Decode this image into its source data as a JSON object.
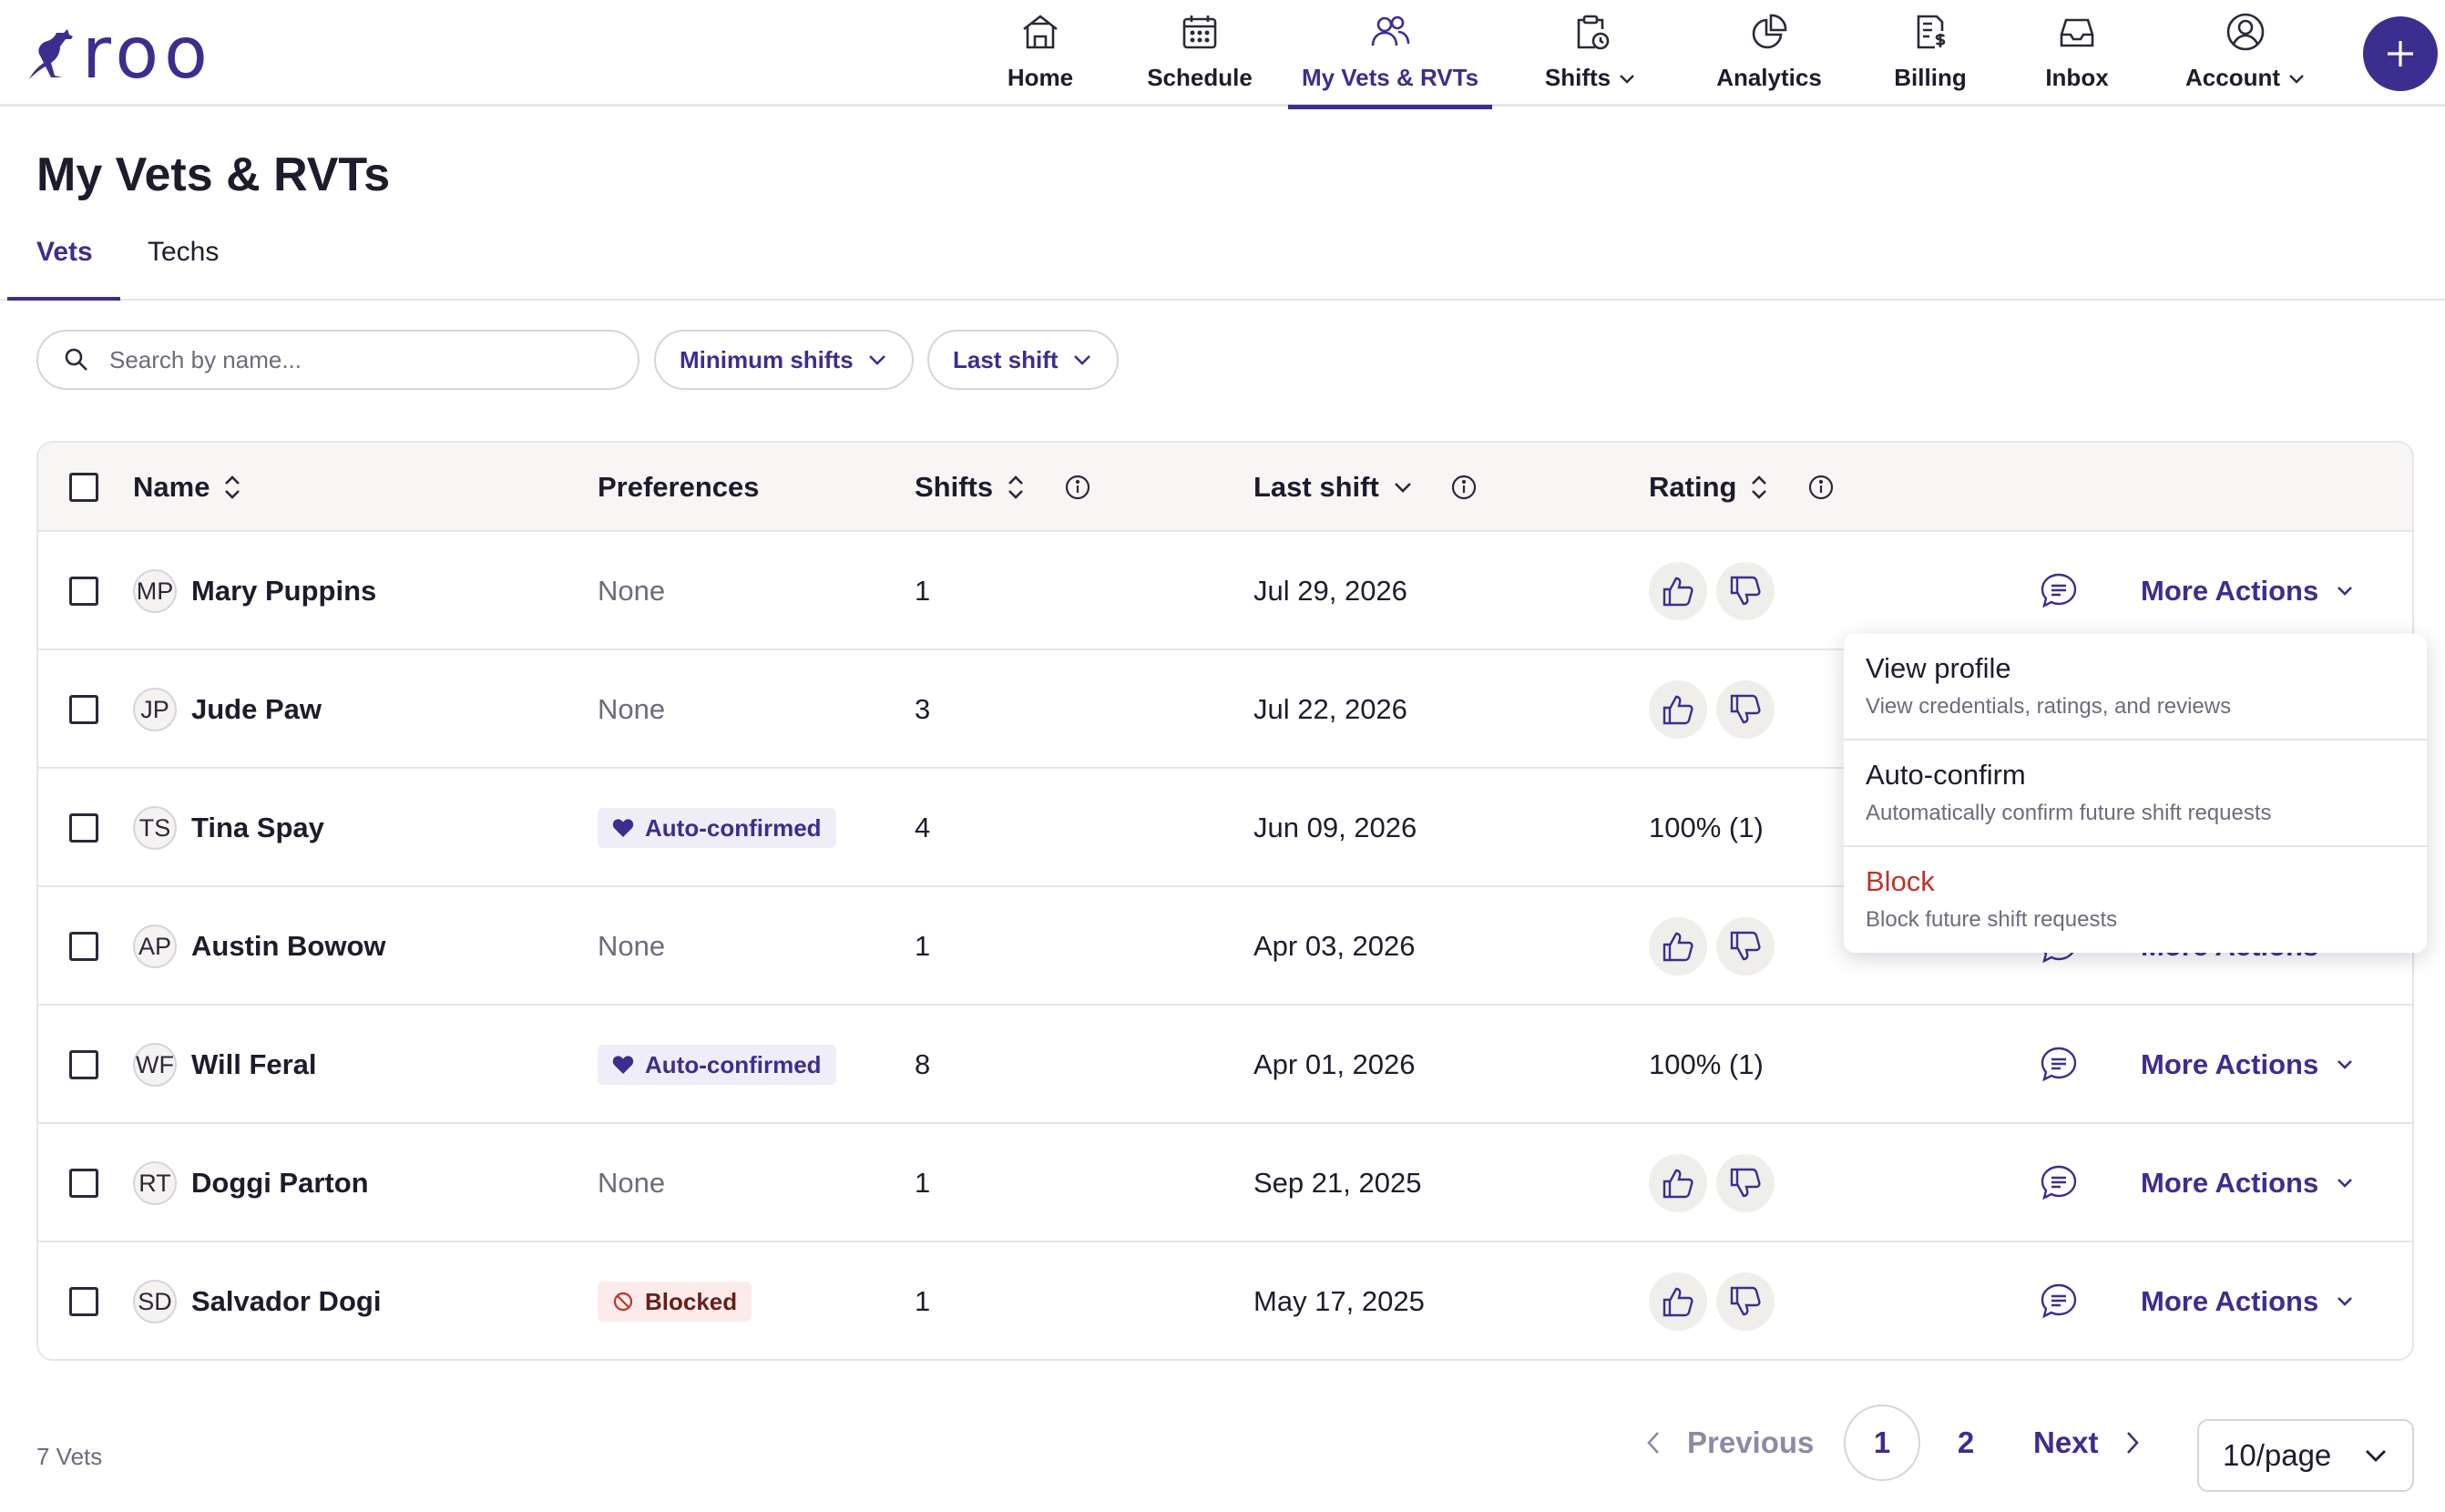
{
  "brand": {
    "name": "roo",
    "color": "#3c2e8f"
  },
  "nav": [
    {
      "label": "Home",
      "icon": "home-icon"
    },
    {
      "label": "Schedule",
      "icon": "calendar-icon"
    },
    {
      "label": "My Vets & RVTs",
      "icon": "people-icon",
      "active": true
    },
    {
      "label": "Shifts",
      "icon": "clipboard-clock-icon",
      "dropdown": true
    },
    {
      "label": "Analytics",
      "icon": "pie-chart-icon"
    },
    {
      "label": "Billing",
      "icon": "invoice-icon"
    },
    {
      "label": "Inbox",
      "icon": "inbox-icon"
    },
    {
      "label": "Account",
      "icon": "account-icon",
      "dropdown": true
    }
  ],
  "page": {
    "title": "My Vets & RVTs"
  },
  "tabs": [
    {
      "label": "Vets",
      "active": true
    },
    {
      "label": "Techs"
    }
  ],
  "filters": {
    "search_placeholder": "Search by name...",
    "min_shifts": "Minimum shifts",
    "last_shift": "Last shift"
  },
  "table": {
    "headers": {
      "name": "Name",
      "preferences": "Preferences",
      "shifts": "Shifts",
      "last_shift": "Last shift",
      "rating": "Rating"
    },
    "rows": [
      {
        "initials": "MP",
        "name": "Mary Puppins",
        "preference": "None",
        "shifts": "1",
        "last_shift": "Jul 29, 2026",
        "rating": "",
        "action": "More Actions"
      },
      {
        "initials": "JP",
        "name": "Jude Paw",
        "preference": "None",
        "shifts": "3",
        "last_shift": "Jul 22, 2026",
        "rating": "",
        "action": "More Actions"
      },
      {
        "initials": "TS",
        "name": "Tina Spay",
        "preference": "Auto-confirmed",
        "shifts": "4",
        "last_shift": "Jun 09, 2026",
        "rating": "100% (1)",
        "action": "More Actions"
      },
      {
        "initials": "AP",
        "name": "Austin Bowow",
        "preference": "None",
        "shifts": "1",
        "last_shift": "Apr 03, 2026",
        "rating": "",
        "action": "More Actions"
      },
      {
        "initials": "WF",
        "name": "Will Feral",
        "preference": "Auto-confirmed",
        "shifts": "8",
        "last_shift": "Apr 01, 2026",
        "rating": "100% (1)",
        "action": "More Actions"
      },
      {
        "initials": "RT",
        "name": "Doggi Parton",
        "preference": "None",
        "shifts": "1",
        "last_shift": "Sep 21, 2025",
        "rating": "",
        "action": "More Actions"
      },
      {
        "initials": "SD",
        "name": "Salvador Dogi",
        "preference": "Blocked",
        "shifts": "1",
        "last_shift": "May 17, 2025",
        "rating": "",
        "action": "More Actions"
      }
    ]
  },
  "menu": [
    {
      "title": "View profile",
      "desc": "View credentials, ratings, and reviews"
    },
    {
      "title": "Auto-confirm",
      "desc": "Automatically confirm future shift requests"
    },
    {
      "title": "Block",
      "desc": "Block future shift requests",
      "danger": true
    }
  ],
  "footer": {
    "count": "7 Vets",
    "previous": "Previous",
    "pages": [
      "1",
      "2"
    ],
    "current_page": "1",
    "next": "Next",
    "per_page": "10/page"
  }
}
